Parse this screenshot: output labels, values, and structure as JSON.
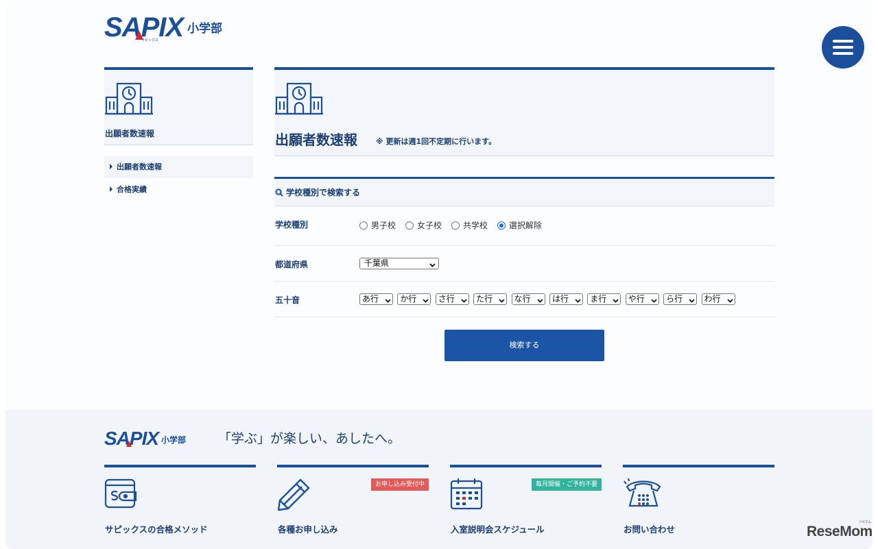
{
  "header": {
    "logo_text": "SAPIX",
    "logo_sub": "小学部",
    "logo_kana": "サピックス",
    "menu_icon": "hamburger-menu-icon"
  },
  "sidebar": {
    "title": "出願者数速報",
    "icon": "school-building-icon",
    "items": [
      {
        "label": "出願者数速報",
        "active": true
      },
      {
        "label": "合格実績",
        "active": false
      }
    ]
  },
  "main": {
    "title": "出願者数速報",
    "note": "※ 更新は週1回不定期に行います。",
    "icon": "school-building-icon",
    "search": {
      "heading": "学校種別で検索する",
      "school_type": {
        "label": "学校種別",
        "options": [
          "男子校",
          "女子校",
          "共学校",
          "選択解除"
        ],
        "selected": "選択解除"
      },
      "prefecture": {
        "label": "都道府県",
        "value": "千葉県"
      },
      "kana": {
        "label": "五十音",
        "options": [
          "あ行",
          "か行",
          "さ行",
          "た行",
          "な行",
          "は行",
          "ま行",
          "や行",
          "ら行",
          "わ行"
        ]
      },
      "submit_label": "検索する"
    }
  },
  "footer": {
    "logo_text": "SAPIX",
    "logo_sub": "小学部",
    "tagline": "「学ぶ」が楽しい、あしたへ。",
    "cards": [
      {
        "label": "サピックスの合格メソッド",
        "icon": "wallet-s-icon",
        "badge": ""
      },
      {
        "label": "各種お申し込み",
        "icon": "pencil-icon",
        "badge": "お申し込み受付中"
      },
      {
        "label": "入室説明会スケジュール",
        "icon": "calendar-icon",
        "badge": "毎月開催・ご予約不要"
      },
      {
        "label": "お問い合わせ",
        "icon": "telephone-icon",
        "badge": ""
      }
    ]
  },
  "watermark": {
    "text": "ReseMom",
    "small": "リセマム"
  },
  "colors": {
    "brand": "#1b4f9c",
    "button": "#1b55a6",
    "badge_red": "#e35a5a",
    "badge_green": "#32b39b"
  }
}
